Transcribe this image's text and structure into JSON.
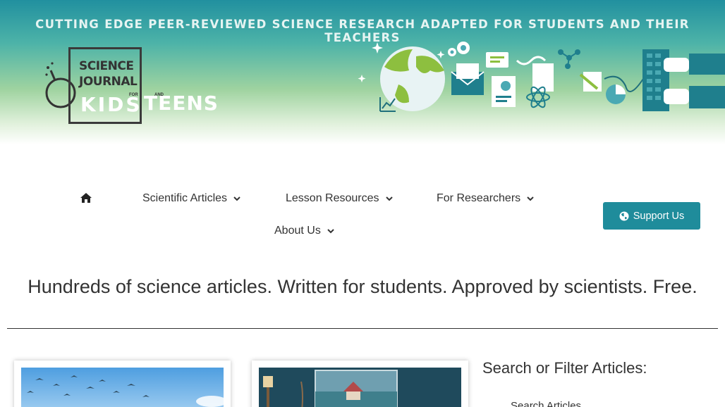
{
  "banner": {
    "tagline": "CUTTING EDGE PEER-REVIEWED SCIENCE RESEARCH ADAPTED FOR STUDENTS AND THEIR TEACHERS",
    "logo": {
      "line1": "SCIENCE",
      "line2": "JOURNAL",
      "for": "FOR",
      "kids": "KIDS",
      "and": "AND",
      "teens": "TEENS"
    }
  },
  "nav": {
    "home_icon": "home-icon",
    "items": [
      {
        "label": "Scientific Articles"
      },
      {
        "label": "Lesson Resources"
      },
      {
        "label": "For Researchers"
      },
      {
        "label": "About Us"
      }
    ],
    "support_label": "Support Us",
    "support_icon": "globe-icon"
  },
  "headline": "Hundreds of science articles. Written for students. Approved by scientists. Free.",
  "filter": {
    "title": "Search or Filter Articles:",
    "search_label": "Search Articles"
  },
  "colors": {
    "accent": "#1f8c9b",
    "banner_top": "#21909f",
    "banner_mid": "#9fd3a0"
  }
}
